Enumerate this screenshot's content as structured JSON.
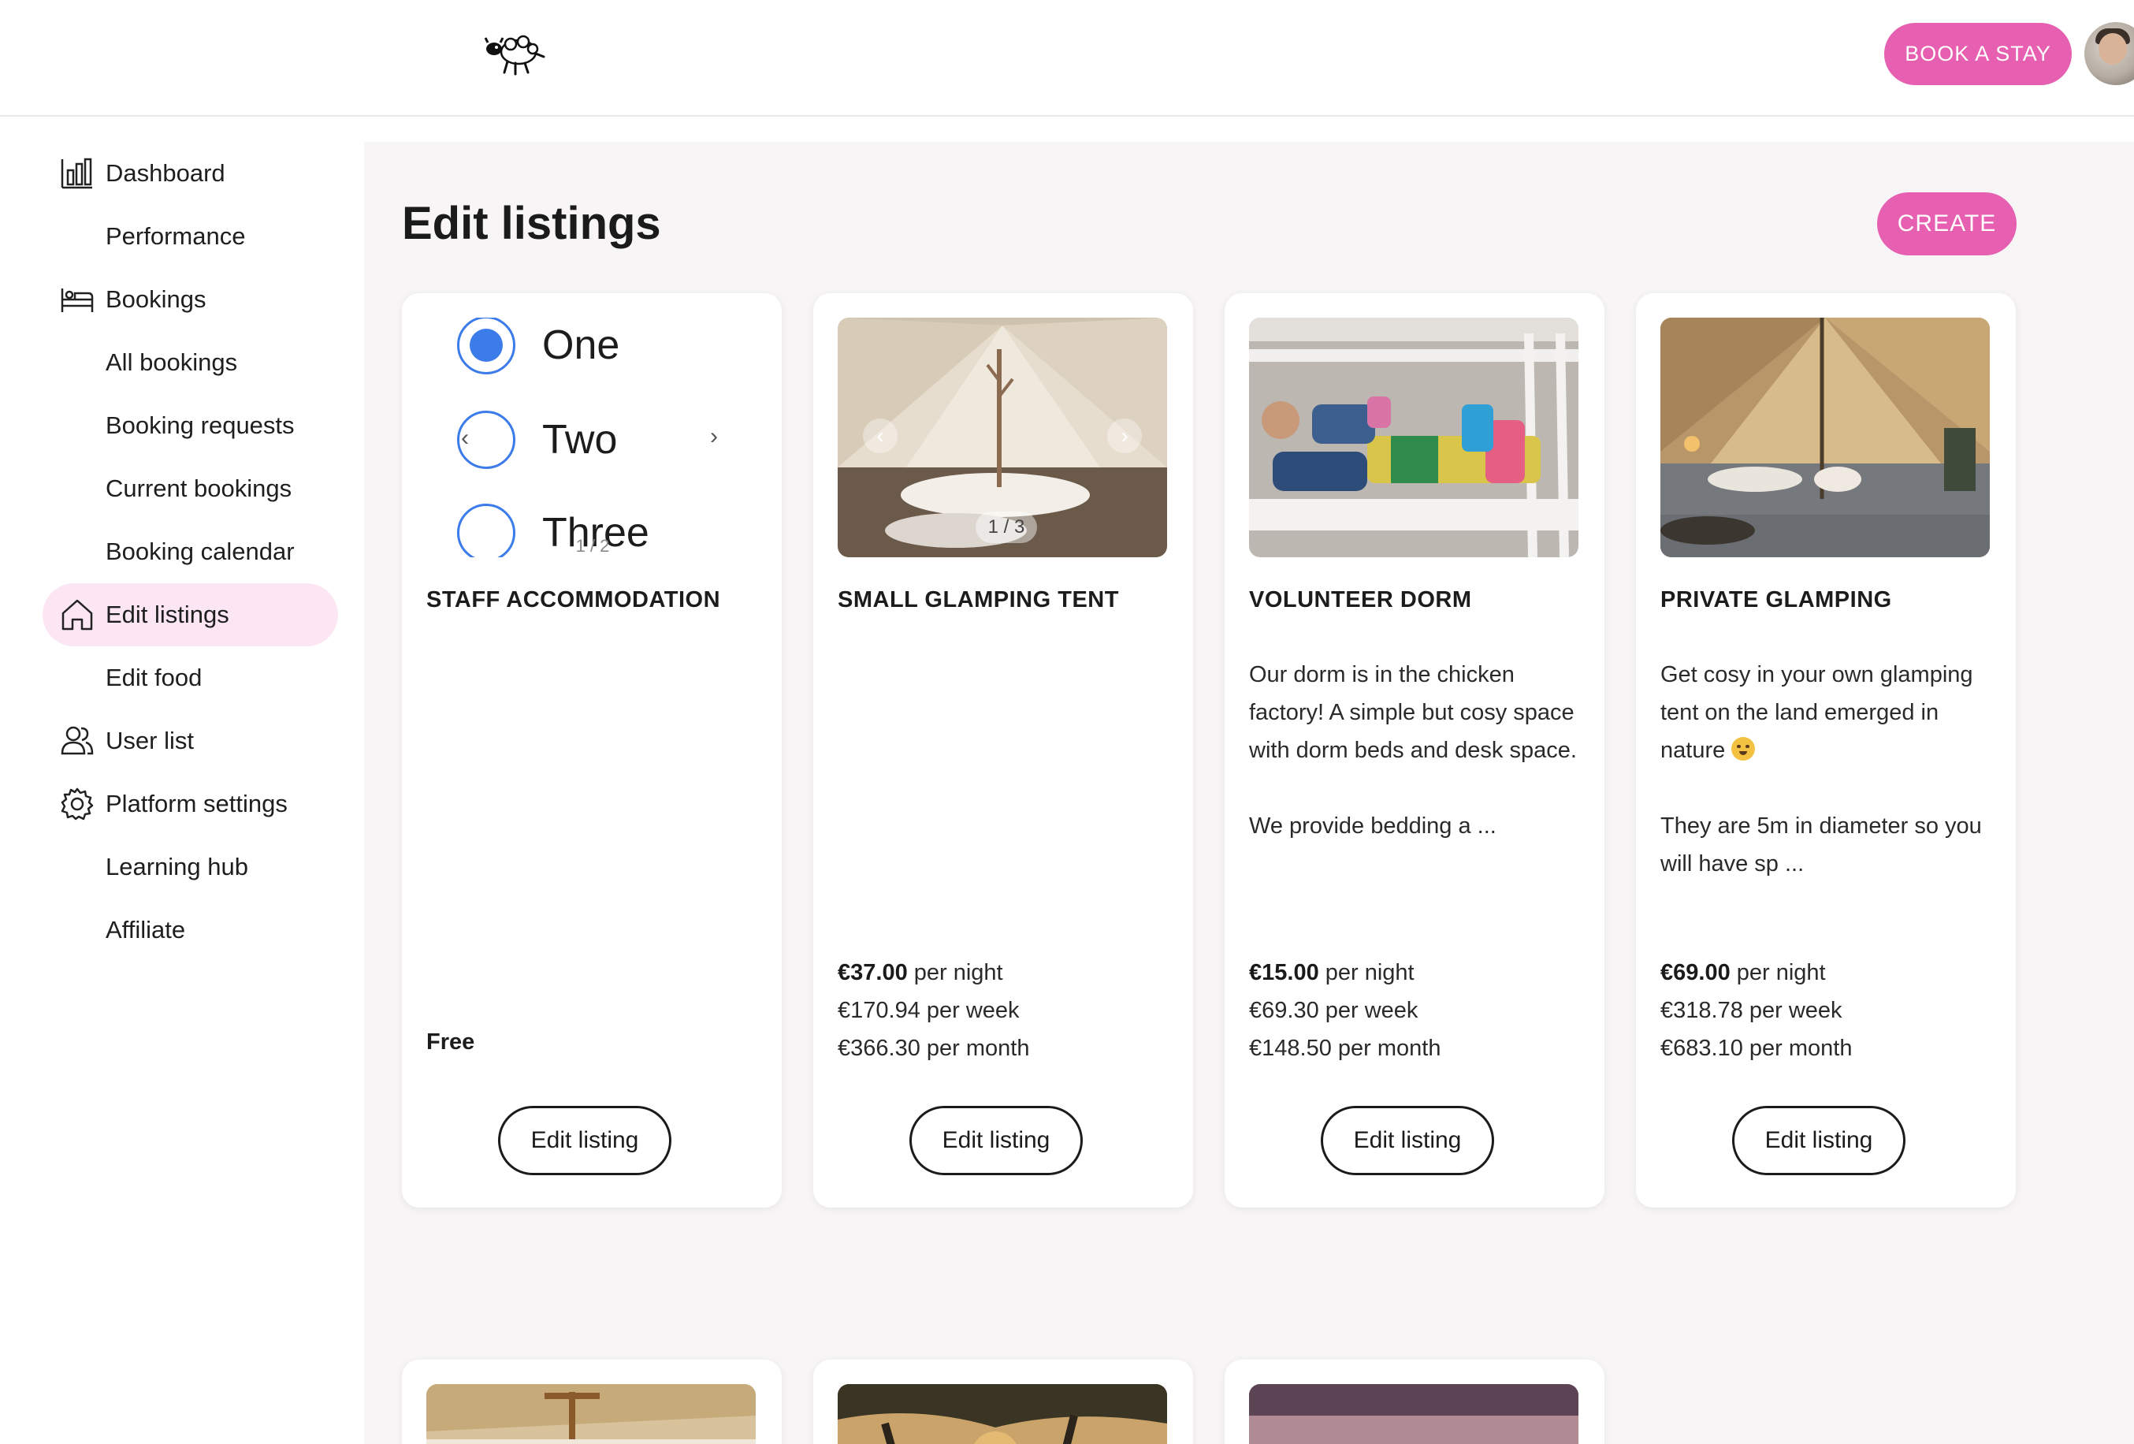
{
  "header": {
    "logo_icon": "sheep-logo-icon",
    "book_label": "BOOK A STAY",
    "avatar_icon": "user-avatar"
  },
  "sidebar": {
    "items": [
      {
        "label": "Dashboard",
        "icon": "bar-chart-icon"
      },
      {
        "label": "Performance",
        "icon": ""
      },
      {
        "label": "Bookings",
        "icon": "bed-icon"
      },
      {
        "label": "All bookings",
        "icon": ""
      },
      {
        "label": "Booking requests",
        "icon": ""
      },
      {
        "label": "Current bookings",
        "icon": ""
      },
      {
        "label": "Booking calendar",
        "icon": ""
      },
      {
        "label": "Edit listings",
        "icon": "home-icon",
        "active": true
      },
      {
        "label": "Edit food",
        "icon": ""
      },
      {
        "label": "User list",
        "icon": "users-icon"
      },
      {
        "label": "Platform settings",
        "icon": "gear-icon"
      },
      {
        "label": "Learning hub",
        "icon": ""
      },
      {
        "label": "Affiliate",
        "icon": ""
      }
    ]
  },
  "main": {
    "title": "Edit listings",
    "create_label": "CREATE",
    "edit_label": "Edit listing",
    "colors": {
      "accent": "#e65fb0",
      "active_bg": "#fce6f3",
      "radio": "#3b7bea"
    }
  },
  "listings": [
    {
      "title": "STAFF ACCOMMODATION",
      "radio_options": [
        "One",
        "Two",
        "Three"
      ],
      "radio_selected": "One",
      "counter": "1 / 2",
      "price_label": "Free"
    },
    {
      "title": "SMALL GLAMPING TENT",
      "counter": "1 / 3",
      "night_price": "€37.00",
      "night_suffix": " per night",
      "week": "€170.94 per week",
      "month": "€366.30 per month"
    },
    {
      "title": "VOLUNTEER DORM",
      "desc1": "Our dorm is in the chicken factory! A simple but cosy space with dorm beds and desk space.",
      "desc2": "We provide bedding a ...",
      "night_price": "€15.00",
      "night_suffix": " per night",
      "week": "€69.30 per week",
      "month": "€148.50 per month"
    },
    {
      "title": "PRIVATE GLAMPING",
      "desc1": "Get cosy in your own glamping tent on the land emerged in nature",
      "desc2": "They are 5m in diameter so you will have sp ...",
      "night_price": "€69.00",
      "night_suffix": " per night",
      "week": "€318.78 per week",
      "month": "€683.10 per month"
    }
  ]
}
